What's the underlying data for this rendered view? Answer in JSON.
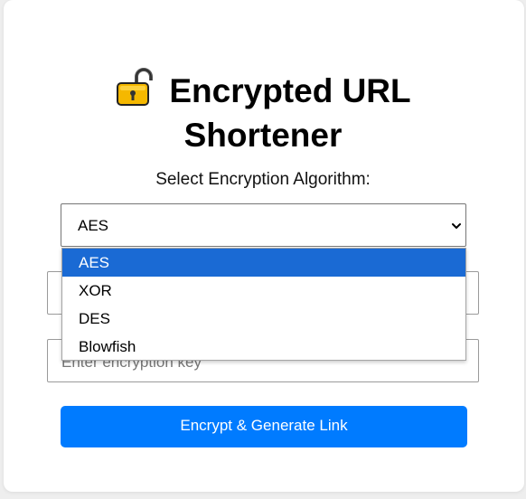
{
  "app": {
    "title_line1": "Encrypted URL",
    "title_line2": "Shortener",
    "title_icon": "locked-padlock-emoji-icon"
  },
  "form": {
    "algorithm_label": "Select Encryption Algorithm:",
    "algorithm_selected": "AES",
    "algorithm_options": [
      "AES",
      "XOR",
      "DES",
      "Blowfish"
    ],
    "url_input_placeholder": "",
    "key_input_placeholder": "Enter encryption key",
    "submit_label": "Encrypt & Generate Link"
  },
  "colors": {
    "primary_button": "#007bff",
    "selected_option": "#1a6ad4",
    "lock_body": "#f5b800"
  }
}
